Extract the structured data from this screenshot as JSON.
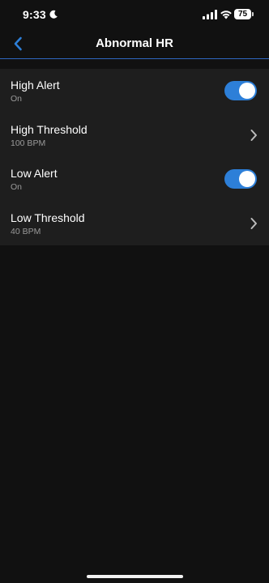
{
  "status_bar": {
    "time": "9:33",
    "battery": "75",
    "icons": [
      "moon-icon",
      "cellular-signal-icon",
      "wifi-icon",
      "battery-icon"
    ]
  },
  "header": {
    "title": "Abnormal HR",
    "back_icon": "chevron-left-icon",
    "accent_color": "#2f66c0"
  },
  "settings": {
    "items": [
      {
        "label": "High Alert",
        "value": "On",
        "control": "toggle",
        "on": true
      },
      {
        "label": "High Threshold",
        "value": "100 BPM",
        "control": "chevron"
      },
      {
        "label": "Low Alert",
        "value": "On",
        "control": "toggle",
        "on": true
      },
      {
        "label": "Low Threshold",
        "value": "40 BPM",
        "control": "chevron"
      }
    ]
  },
  "colors": {
    "background": "#111111",
    "list_background": "#1e1e1e",
    "toggle_on": "#2d7fd8",
    "secondary_text": "#9a9a9a"
  }
}
